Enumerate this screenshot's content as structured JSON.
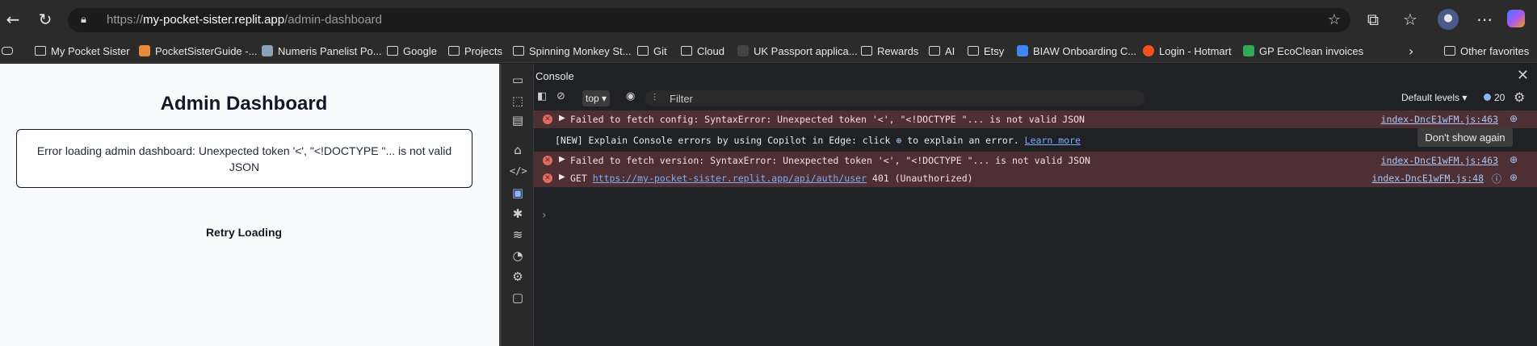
{
  "browser": {
    "url_prefix": "https://",
    "url_host": "my-pocket-sister.replit.app",
    "url_path": "/admin-dashboard"
  },
  "bookmarks": [
    {
      "label": "My Pocket Sister"
    },
    {
      "label": "PocketSisterGuide -..."
    },
    {
      "label": "Numeris Panelist Po..."
    },
    {
      "label": "Google"
    },
    {
      "label": "Projects"
    },
    {
      "label": "Spinning Monkey St..."
    },
    {
      "label": "Git"
    },
    {
      "label": "Cloud"
    },
    {
      "label": "UK Passport applica..."
    },
    {
      "label": "Rewards"
    },
    {
      "label": "AI"
    },
    {
      "label": "Etsy"
    },
    {
      "label": "BIAW Onboarding C..."
    },
    {
      "label": "Login - Hotmart"
    },
    {
      "label": "GP EcoClean invoices"
    },
    {
      "label": "Other favorites"
    }
  ],
  "page": {
    "title": "Admin Dashboard",
    "error_message": "Error loading admin dashboard: Unexpected token '<', \"<!DOCTYPE \"... is not valid JSON",
    "retry_label": "Retry Loading"
  },
  "devtools": {
    "panel_title": "Console",
    "context": "top",
    "filter_placeholder": "Filter",
    "levels_label": "Default levels",
    "issues_count": "20",
    "messages": [
      {
        "type": "error",
        "text": "Failed to fetch config: SyntaxError: Unexpected token '<', \"<!DOCTYPE \"... is not valid JSON",
        "source": "index-DncE1wFM.js:463"
      },
      {
        "type": "info",
        "text_before": "[NEW] Explain Console errors by using Copilot in Edge: click",
        "text_after": "to explain an error.",
        "link": "Learn more",
        "button": "Don't show again"
      },
      {
        "type": "error",
        "text": "Failed to fetch version: SyntaxError: Unexpected token '<', \"<!DOCTYPE \"... is not valid JSON",
        "source": "index-DncE1wFM.js:463"
      },
      {
        "type": "error",
        "text_prefix": "GET",
        "url": "https://my-pocket-sister.replit.app/api/auth/user",
        "text_suffix": "401 (Unauthorized)",
        "source": "index-DncE1wFM.js:48"
      }
    ]
  },
  "colors": {
    "error_bg": "#4e3034",
    "link": "#7cacf8",
    "page_bg": "#f9fafb"
  }
}
